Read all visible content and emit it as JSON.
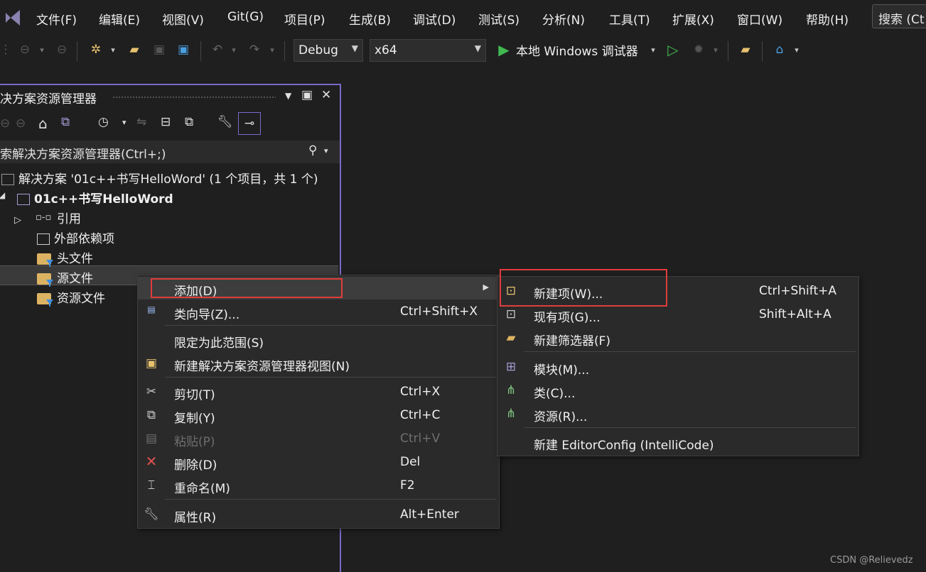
{
  "menubar": {
    "items": [
      "文件(F)",
      "编辑(E)",
      "视图(V)",
      "Git(G)",
      "项目(P)",
      "生成(B)",
      "调试(D)",
      "测试(S)",
      "分析(N)",
      "工具(T)",
      "扩展(X)",
      "窗口(W)",
      "帮助(H)"
    ],
    "search_label": "搜索 (Ct"
  },
  "toolbar": {
    "config": "Debug",
    "platform": "x64",
    "run_label": "本地 Windows 调试器"
  },
  "solution_explorer": {
    "title": "决方案资源管理器",
    "search_placeholder": "索解决方案资源管理器(Ctrl+;)",
    "solution_label": "解决方案 '01c++书写HelloWord' (1 个项目，共 1 个)",
    "project_label": "01c++书写HelloWord",
    "items": [
      "引用",
      "外部依赖项",
      "头文件",
      "源文件",
      "资源文件"
    ]
  },
  "context_menu": {
    "items": [
      {
        "label": "添加(D)",
        "shortcut": ""
      },
      {
        "label": "类向导(Z)...",
        "shortcut": "Ctrl+Shift+X"
      },
      {
        "label": "限定为此范围(S)",
        "shortcut": ""
      },
      {
        "label": "新建解决方案资源管理器视图(N)",
        "shortcut": ""
      },
      {
        "label": "剪切(T)",
        "shortcut": "Ctrl+X"
      },
      {
        "label": "复制(Y)",
        "shortcut": "Ctrl+C"
      },
      {
        "label": "粘贴(P)",
        "shortcut": "Ctrl+V"
      },
      {
        "label": "删除(D)",
        "shortcut": "Del"
      },
      {
        "label": "重命名(M)",
        "shortcut": "F2"
      },
      {
        "label": "属性(R)",
        "shortcut": "Alt+Enter"
      }
    ]
  },
  "submenu": {
    "items": [
      {
        "label": "新建项(W)...",
        "shortcut": "Ctrl+Shift+A"
      },
      {
        "label": "现有项(G)...",
        "shortcut": "Shift+Alt+A"
      },
      {
        "label": "新建筛选器(F)",
        "shortcut": ""
      },
      {
        "label": "模块(M)...",
        "shortcut": ""
      },
      {
        "label": "类(C)...",
        "shortcut": ""
      },
      {
        "label": "资源(R)...",
        "shortcut": ""
      },
      {
        "label": "新建 EditorConfig (IntelliCode)",
        "shortcut": ""
      }
    ]
  },
  "watermark": "CSDN @Relievedz",
  "colors": {
    "accent": "#7b68c8",
    "highlight_box": "#e03c3c",
    "run_green": "#3fb950"
  }
}
